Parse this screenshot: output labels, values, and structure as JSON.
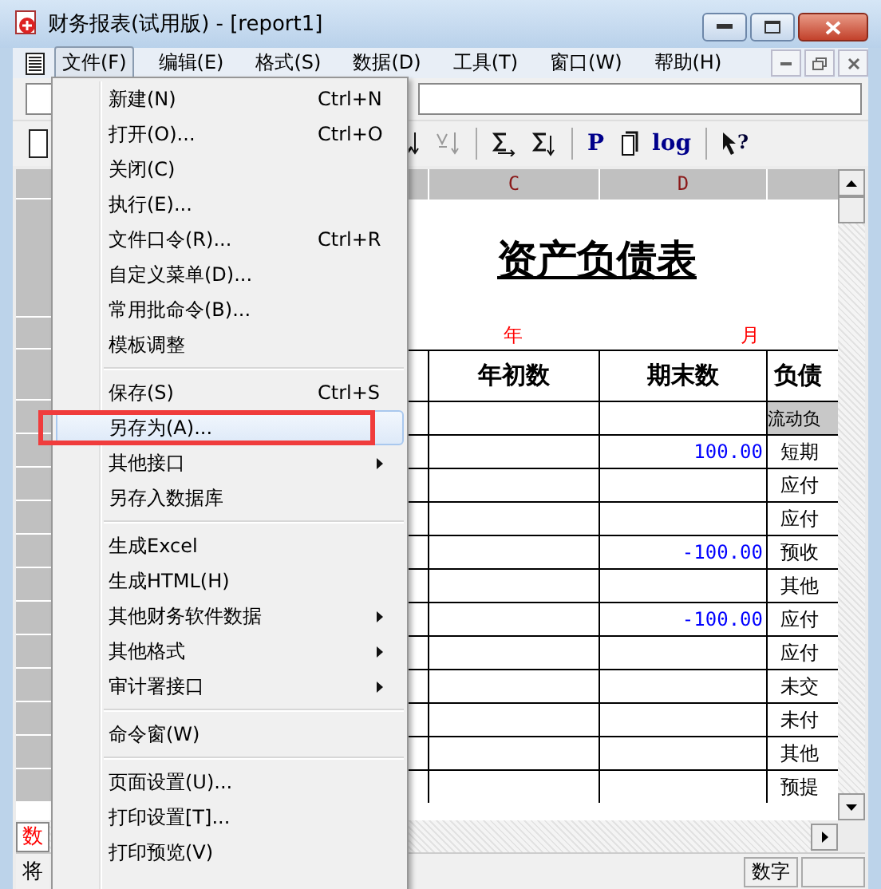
{
  "window": {
    "title": "财务报表(试用版) - [report1]"
  },
  "menubar": [
    {
      "label": "文件(F)",
      "selected": true
    },
    {
      "label": "编辑(E)",
      "selected": false
    },
    {
      "label": "格式(S)",
      "selected": false
    },
    {
      "label": "数据(D)",
      "selected": false
    },
    {
      "label": "工具(T)",
      "selected": false
    },
    {
      "label": "窗口(W)",
      "selected": false
    },
    {
      "label": "帮助(H)",
      "selected": false
    }
  ],
  "file_menu": [
    {
      "kind": "item",
      "label": "新建(N)",
      "shortcut": "Ctrl+N",
      "selected": false
    },
    {
      "kind": "item",
      "label": "打开(O)...",
      "shortcut": "Ctrl+O",
      "selected": false
    },
    {
      "kind": "item",
      "label": "关闭(C)",
      "selected": false
    },
    {
      "kind": "item",
      "label": "执行(E)...",
      "selected": false
    },
    {
      "kind": "item",
      "label": "文件口令(R)...",
      "shortcut": "Ctrl+R",
      "selected": false
    },
    {
      "kind": "item",
      "label": "自定义菜单(D)...",
      "selected": false
    },
    {
      "kind": "item",
      "label": "常用批命令(B)...",
      "selected": false
    },
    {
      "kind": "item",
      "label": "模板调整",
      "selected": false
    },
    {
      "kind": "separator"
    },
    {
      "kind": "item",
      "label": "保存(S)",
      "shortcut": "Ctrl+S",
      "selected": false
    },
    {
      "kind": "item",
      "label": "另存为(A)...",
      "selected": true
    },
    {
      "kind": "submenu",
      "label": "其他接口",
      "selected": false
    },
    {
      "kind": "item",
      "label": "另存入数据库",
      "selected": false
    },
    {
      "kind": "separator"
    },
    {
      "kind": "item",
      "label": "生成Excel",
      "selected": false
    },
    {
      "kind": "item",
      "label": "生成HTML(H)",
      "selected": false
    },
    {
      "kind": "submenu",
      "label": "其他财务软件数据",
      "selected": false
    },
    {
      "kind": "submenu",
      "label": "其他格式",
      "selected": false
    },
    {
      "kind": "submenu",
      "label": "审计署接口",
      "selected": false
    },
    {
      "kind": "separator"
    },
    {
      "kind": "item",
      "label": "命令窗(W)",
      "selected": false
    },
    {
      "kind": "separator"
    },
    {
      "kind": "item",
      "label": "页面设置(U)...",
      "selected": false
    },
    {
      "kind": "item",
      "label": "打印设置[T]...",
      "selected": false
    },
    {
      "kind": "item",
      "label": "打印预览(V)",
      "selected": false
    }
  ],
  "toolbar": [
    {
      "kind": "sort-down"
    },
    {
      "kind": "sort-down-disabled"
    },
    {
      "kind": "divider"
    },
    {
      "kind": "sum-right"
    },
    {
      "kind": "sum-down"
    },
    {
      "kind": "divider"
    },
    {
      "kind": "text",
      "label": "P"
    },
    {
      "kind": "page"
    },
    {
      "kind": "text",
      "label": "log"
    },
    {
      "kind": "divider"
    },
    {
      "kind": "help",
      "label": "?"
    }
  ],
  "sheet": {
    "columns": [
      "C",
      "D"
    ],
    "title": "资产负债表",
    "year_label": "年",
    "month_label": "月",
    "headers": [
      "年初数",
      "期末数",
      "负债"
    ],
    "rows": [
      {
        "item": "流动负",
        "section": true
      },
      {
        "closing": "100.00",
        "item": "短期",
        "section": false
      },
      {
        "item": "应付",
        "section": false
      },
      {
        "item": "应付",
        "section": false
      },
      {
        "closing": "-100.00",
        "item": "预收",
        "section": false
      },
      {
        "item": "其他",
        "section": false
      },
      {
        "closing": "-100.00",
        "item": "应付",
        "section": false
      },
      {
        "item": "应付",
        "section": false
      },
      {
        "item": "未交",
        "section": false
      },
      {
        "item": "未付",
        "section": false
      },
      {
        "item": "其他",
        "section": false
      },
      {
        "item": "预提",
        "section": false
      }
    ]
  },
  "sheet_tab": "数",
  "status_bar": {
    "message": "将",
    "mode": "数字"
  }
}
